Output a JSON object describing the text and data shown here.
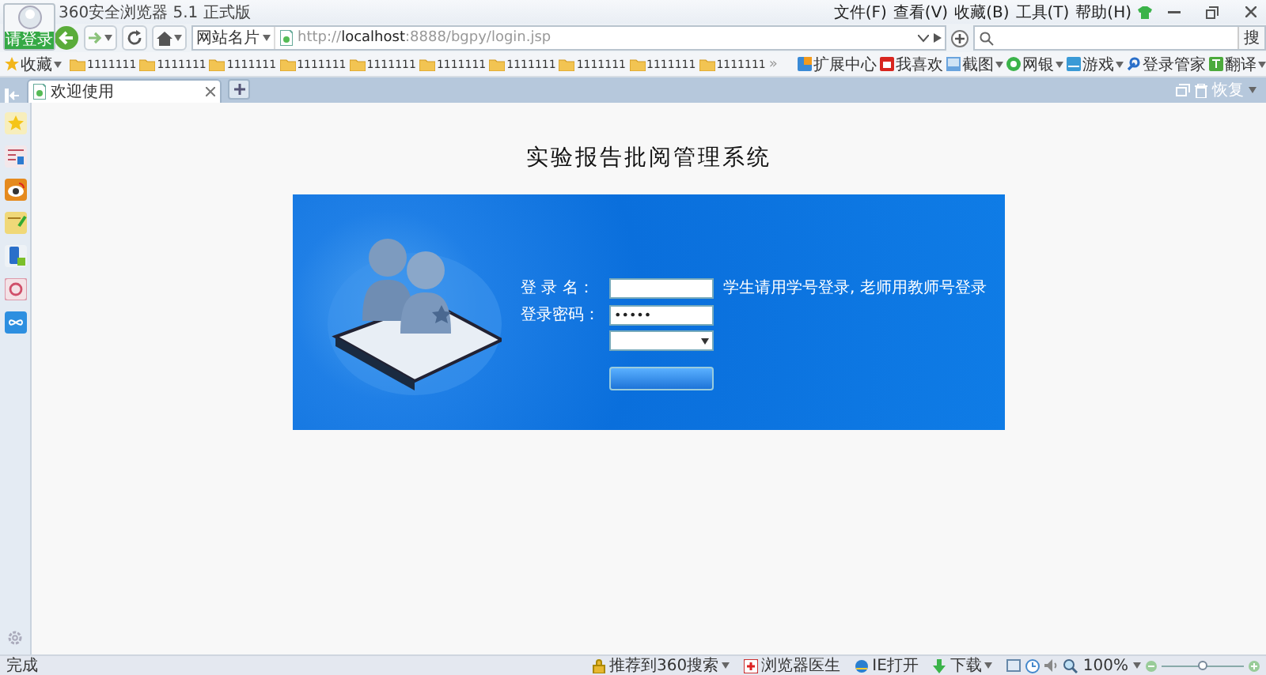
{
  "window": {
    "title": "360安全浏览器 5.1 正式版",
    "login_button": "请登录",
    "menu": [
      "文件(F)",
      "查看(V)",
      "收藏(B)",
      "工具(T)",
      "帮助(H)"
    ]
  },
  "navbar": {
    "site_card": "网站名片",
    "url_scheme": "http://",
    "url_host": "localhost",
    "url_rest": ":8888/bgpy/login.jsp",
    "search_button": "搜"
  },
  "bookmarks": {
    "favorites": "收藏",
    "folders": [
      "1111111",
      "1111111",
      "1111111",
      "1111111",
      "1111111",
      "1111111",
      "1111111",
      "1111111",
      "1111111",
      "1111111"
    ],
    "more": "»",
    "tools": [
      {
        "label": "扩展中心",
        "caret": false
      },
      {
        "label": "我喜欢",
        "caret": false
      },
      {
        "label": "截图",
        "caret": true
      },
      {
        "label": "网银",
        "caret": true
      },
      {
        "label": "游戏",
        "caret": true
      },
      {
        "label": "登录管家",
        "caret": false
      },
      {
        "label": "翻译",
        "caret": true
      }
    ]
  },
  "tabs": [
    {
      "label": "欢迎使用",
      "selected": true
    }
  ],
  "tab_bar": {
    "restore": "恢复"
  },
  "page": {
    "heading": "实验报告批阅管理系统",
    "form": {
      "username_label": "登 录 名：",
      "password_label": "登录密码：",
      "password_value": "•••••",
      "hint": "学生请用学号登录, 老师用教师号登录"
    }
  },
  "status_bar": {
    "text": "完成",
    "items": [
      {
        "label": "推荐到360搜索",
        "caret": true
      },
      {
        "label": "浏览器医生",
        "caret": false
      },
      {
        "label": "IE打开",
        "caret": false
      },
      {
        "label": "下载",
        "caret": true
      }
    ],
    "zoom": "100%",
    "zoom_slider": {
      "level": 0.5
    }
  }
}
